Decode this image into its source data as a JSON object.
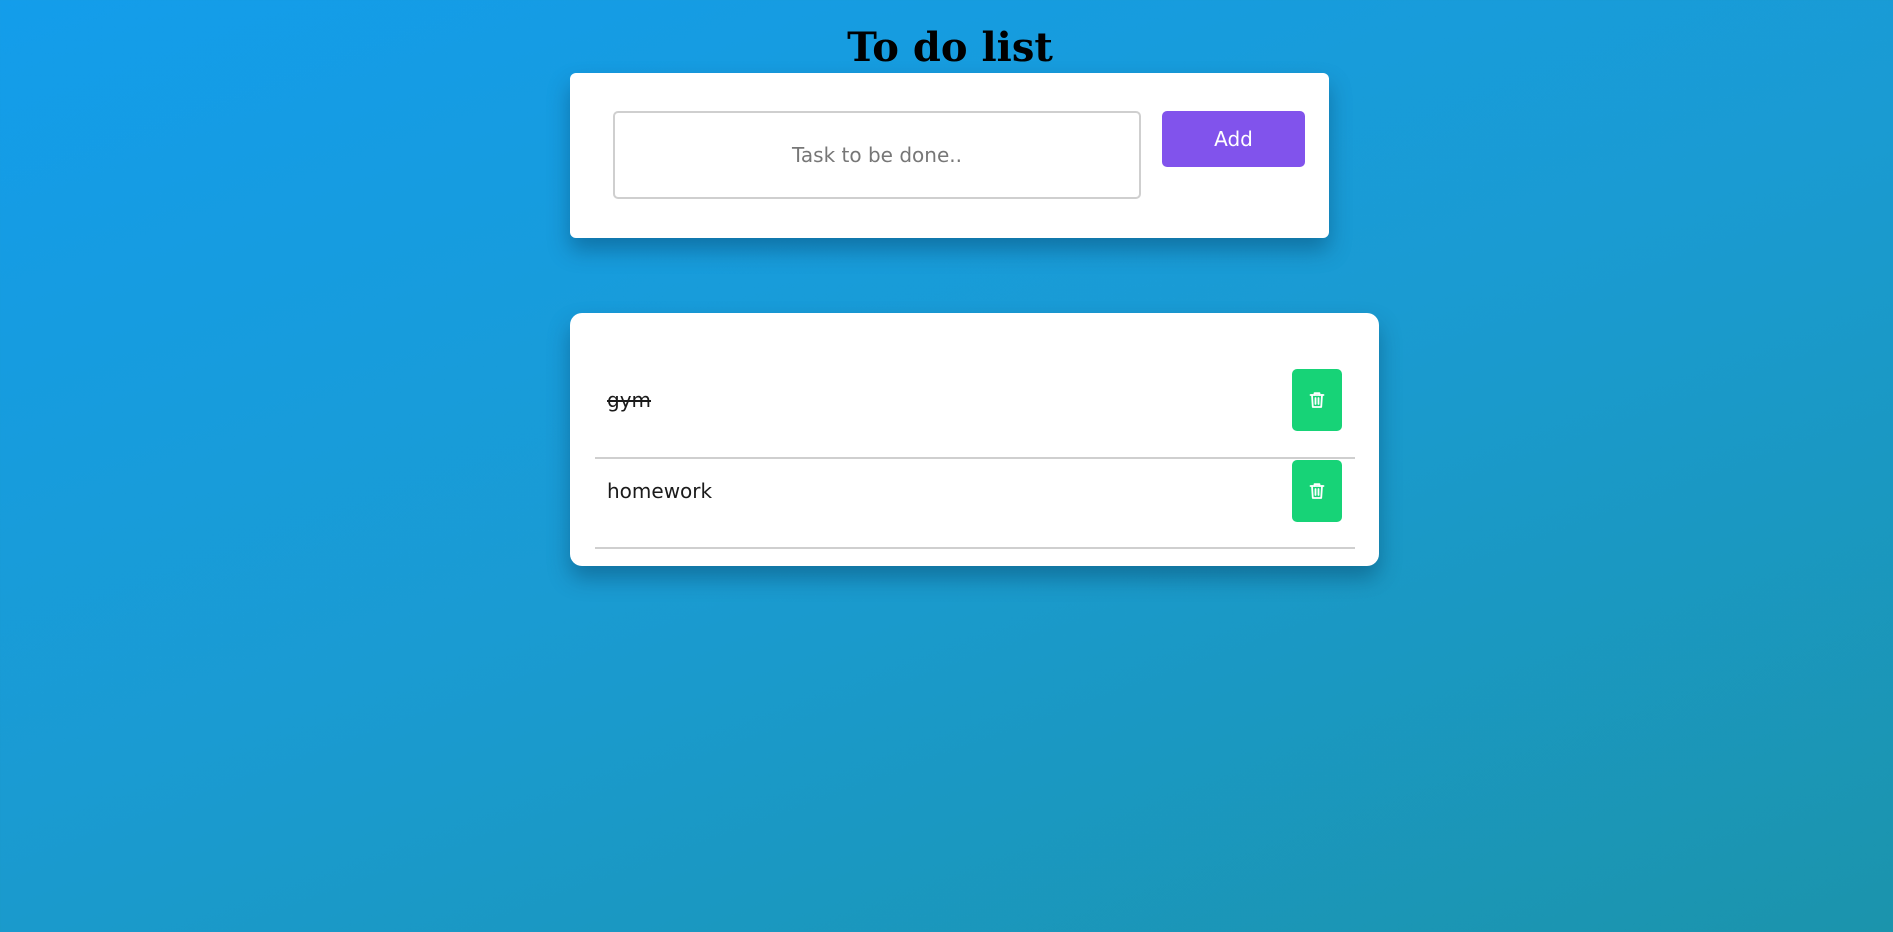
{
  "page": {
    "title": "To do list"
  },
  "form": {
    "input_placeholder": "Task to be done..",
    "input_value": "",
    "add_label": "Add"
  },
  "tasks": [
    {
      "text": "gym",
      "completed": true,
      "delete_icon": "trash-icon"
    },
    {
      "text": "homework",
      "completed": false,
      "delete_icon": "trash-icon"
    }
  ],
  "colors": {
    "add_button": "#8153ec",
    "delete_button": "#17d377",
    "background_start": "#139deb",
    "background_end": "#1b94ac"
  }
}
